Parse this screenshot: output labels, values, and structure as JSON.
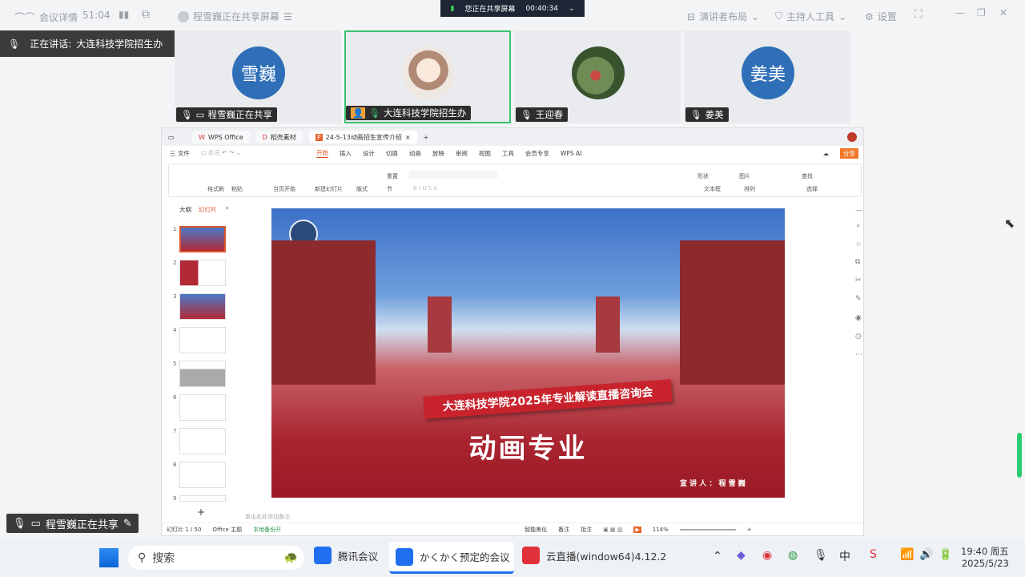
{
  "topbar": {
    "meeting_details": "会议详情",
    "duration": "51:04",
    "sharing_status": "程雪巍正在共享屏幕",
    "presenter_layout": "演讲者布局",
    "host_tools": "主持人工具",
    "settings": "设置"
  },
  "share_bar": {
    "status": "您正在共享屏幕",
    "time": "00:40:34"
  },
  "speaker": {
    "label": "正在讲话:",
    "name": "大连科技学院招生办"
  },
  "participants": [
    {
      "avatar_text": "雪巍",
      "name": "程雪巍正在共享",
      "color": "#2f6fb8"
    },
    {
      "avatar_text": "",
      "name": "大连科技学院招生办",
      "color": "#e3d6cc"
    },
    {
      "avatar_text": "",
      "name": "王迎春",
      "color": "#5b7d4a"
    },
    {
      "avatar_text": "姜美",
      "name": "姜美",
      "color": "#2f6fb8"
    }
  ],
  "wps": {
    "tabs": [
      "WPS Office",
      "稻壳素材",
      "24-5-13动画招生宣传介绍"
    ],
    "file_menu": "三 文件",
    "menu": [
      "开始",
      "插入",
      "设计",
      "切换",
      "动画",
      "放映",
      "审阅",
      "视图",
      "工具",
      "会员专享",
      "WPS AI"
    ],
    "share": "分享",
    "ribbon": {
      "format_painter": "格式刷",
      "paste": "粘贴",
      "start_from": "当页开始",
      "new_slide": "新建幻灯片",
      "layout": "版式",
      "section": "节",
      "reset": "重置",
      "shape": "形状",
      "picture": "图片",
      "find": "查找",
      "textbox": "文本框",
      "arrange": "排列",
      "select": "选择"
    },
    "panel_tabs": {
      "outline": "大纲",
      "slides": "幻灯片"
    },
    "thumb_numbers": [
      "1",
      "2",
      "3",
      "4",
      "5",
      "6",
      "7",
      "8",
      "9"
    ],
    "notes_placeholder": "单击此处添加备注",
    "status": {
      "slide_count": "幻灯片 1 / 50",
      "theme": "Office 主题",
      "backup": "本地备份开",
      "beautify": "智能美化",
      "notes": "备注",
      "comments": "批注",
      "zoom": "114%"
    }
  },
  "slide": {
    "banner": "大连科技学院2025年专业解读直播咨询会",
    "title": "动画专业",
    "presenter": "宣 讲 人 ： 程 雪 巍"
  },
  "sharing_tag": "程雪巍正在共享",
  "taskbar": {
    "search": "搜索",
    "apps": [
      "腾讯会议",
      "かくかく预定的会议",
      "云直播(window64)4.12.2"
    ],
    "time": "19:40 周五",
    "date": "2025/5/23"
  }
}
